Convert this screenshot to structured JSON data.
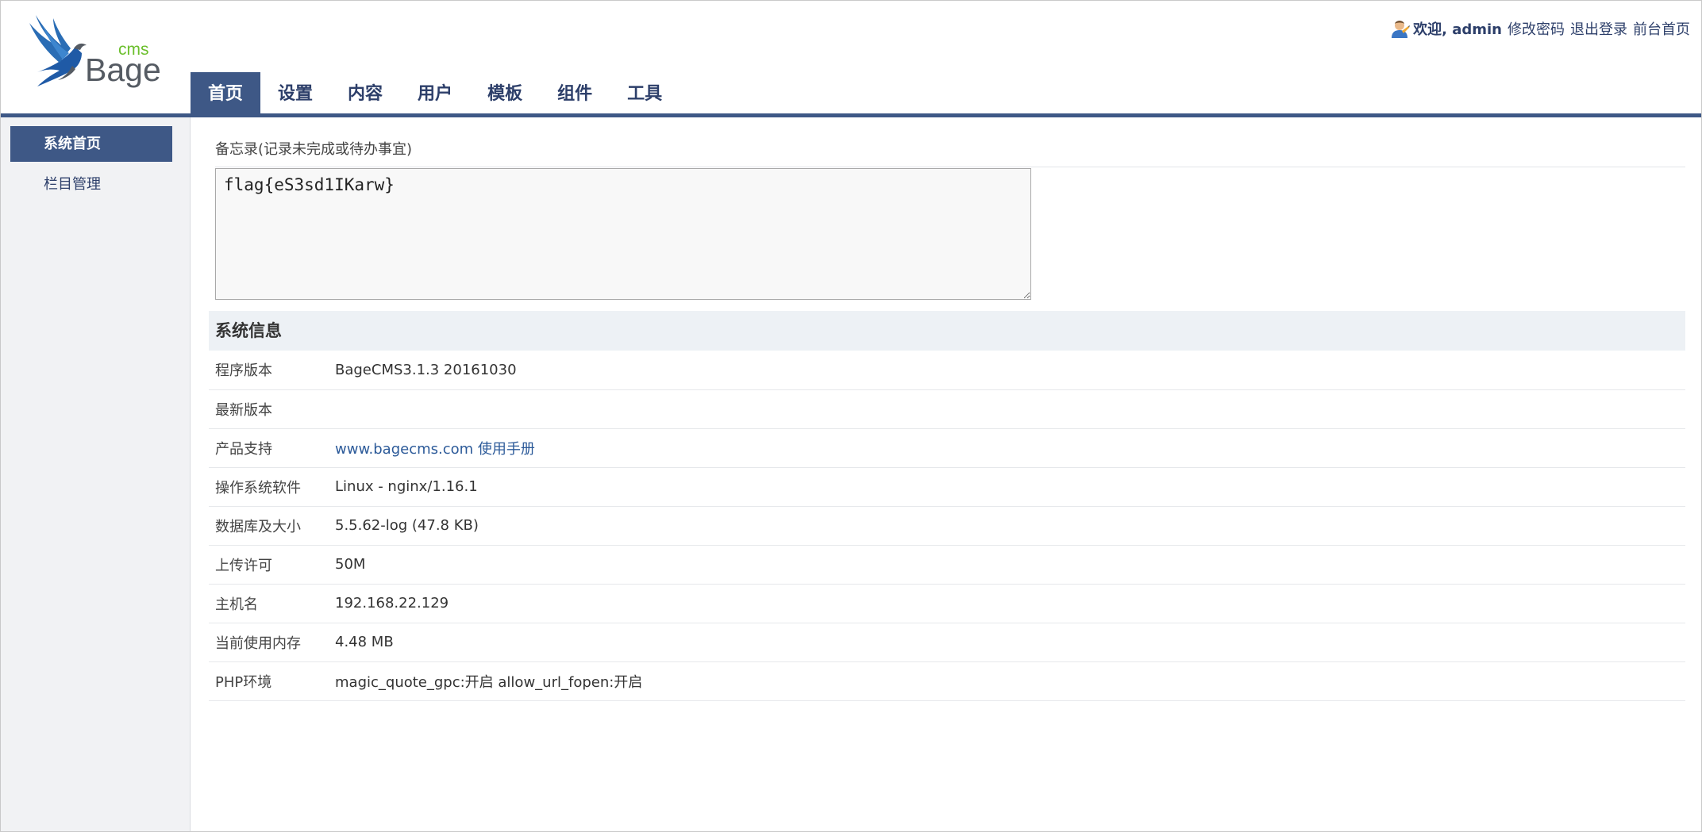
{
  "header": {
    "logo": {
      "brand": "Bage",
      "sub": "cms"
    },
    "user": {
      "welcome": "欢迎, admin",
      "links": [
        "修改密码",
        "退出登录",
        "前台首页"
      ]
    },
    "nav": {
      "tabs": [
        "首页",
        "设置",
        "内容",
        "用户",
        "模板",
        "组件",
        "工具"
      ],
      "active_index": 0
    }
  },
  "sidebar": {
    "items": [
      "系统首页",
      "栏目管理"
    ],
    "active_index": 0
  },
  "memo": {
    "label": "备忘录(记录未完成或待办事宜)",
    "value": "flag{eS3sd1IKarw}"
  },
  "sysinfo": {
    "title": "系统信息",
    "rows": [
      {
        "label": "程序版本",
        "value": "BageCMS3.1.3 20161030"
      },
      {
        "label": "最新版本",
        "value": ""
      },
      {
        "label": "产品支持",
        "link1": "www.bagecms.com",
        "link2": "使用手册"
      },
      {
        "label": "操作系统软件",
        "value": "Linux - nginx/1.16.1"
      },
      {
        "label": "数据库及大小",
        "value": "5.5.62-log (47.8 KB)"
      },
      {
        "label": "上传许可",
        "value": "50M"
      },
      {
        "label": "主机名",
        "value": "192.168.22.129"
      },
      {
        "label": "当前使用内存",
        "value": "4.48 MB"
      },
      {
        "label": "PHP环境",
        "value": "magic_quote_gpc:开启 allow_url_fopen:开启"
      }
    ]
  },
  "colors": {
    "nav_active_bg": "#3e5886",
    "nav_text": "#2d3f6a",
    "sidebar_bg": "#f1f2f4",
    "link": "#2c5a99",
    "logo_green": "#6bbf2c",
    "logo_blue": "#2a6db5"
  },
  "icons": [
    "bird-logo-icon",
    "user-icon"
  ]
}
